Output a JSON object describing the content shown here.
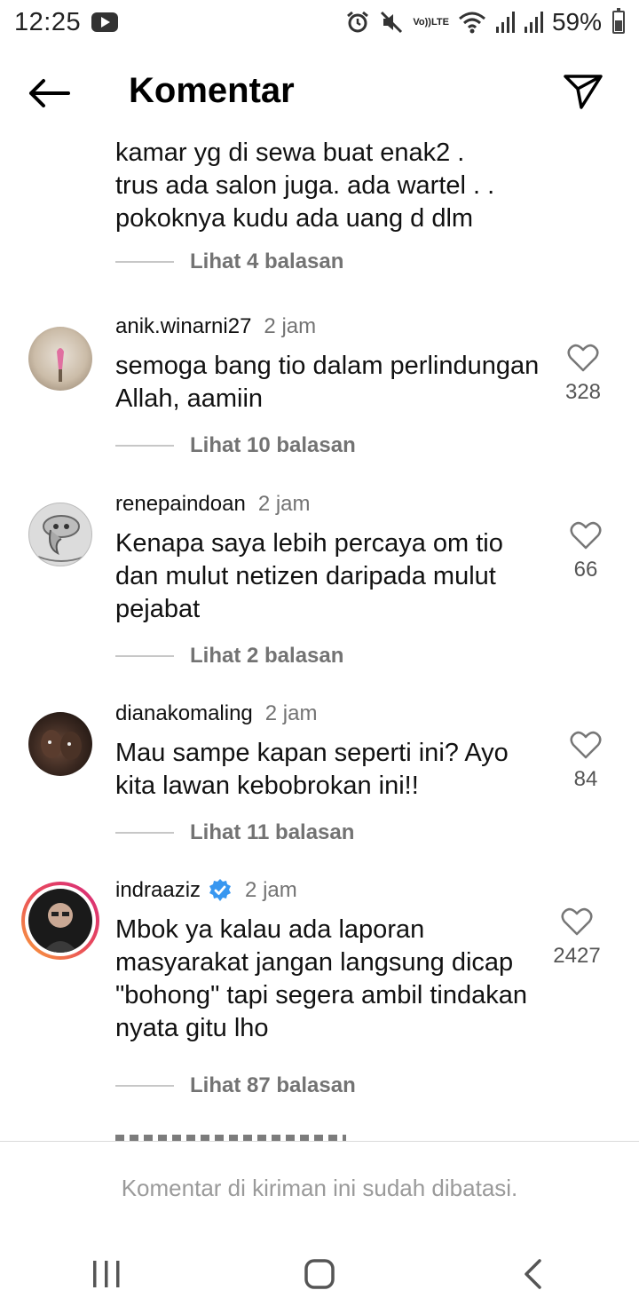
{
  "status_bar": {
    "time": "12:25",
    "battery": "59%",
    "network": "LTE",
    "volte": "Vo))"
  },
  "header": {
    "title": "Komentar"
  },
  "partial_comment": {
    "text": "kamar yg di sewa buat enak2 .\ntrus ada salon juga.  ada wartel . .\npokoknya kudu ada uang d dlm",
    "replies": "Lihat 4 balasan"
  },
  "comments": [
    {
      "username": "anik.winarni27",
      "time": "2 jam",
      "text": "semoga bang tio dalam perlindungan Allah, aamiin",
      "likes": "328",
      "replies": "Lihat 10 balasan",
      "verified": false
    },
    {
      "username": "renepaindoan",
      "time": "2 jam",
      "text": "Kenapa saya lebih percaya om tio dan mulut netizen daripada mulut pejabat",
      "likes": "66",
      "replies": "Lihat 2 balasan",
      "verified": false
    },
    {
      "username": "dianakomaling",
      "time": "2 jam",
      "text": "Mau sampe kapan seperti ini? Ayo kita lawan kebobrokan ini!!",
      "likes": "84",
      "replies": "Lihat 11 balasan",
      "verified": false
    },
    {
      "username": "indraaziz",
      "time": "2 jam",
      "text": "Mbok ya kalau ada laporan masyarakat jangan langsung dicap \"bohong\" tapi segera ambil tindakan nyata gitu lho",
      "likes": "2427",
      "replies": "Lihat 87 balasan",
      "verified": true
    }
  ],
  "footer": {
    "text": "Komentar di kiriman ini sudah dibatasi."
  },
  "colors": {
    "secondary_text": "#737373",
    "verified_blue": "#3897f0",
    "story_ring_start": "#f9a13a",
    "story_ring_end": "#d62a7c"
  }
}
